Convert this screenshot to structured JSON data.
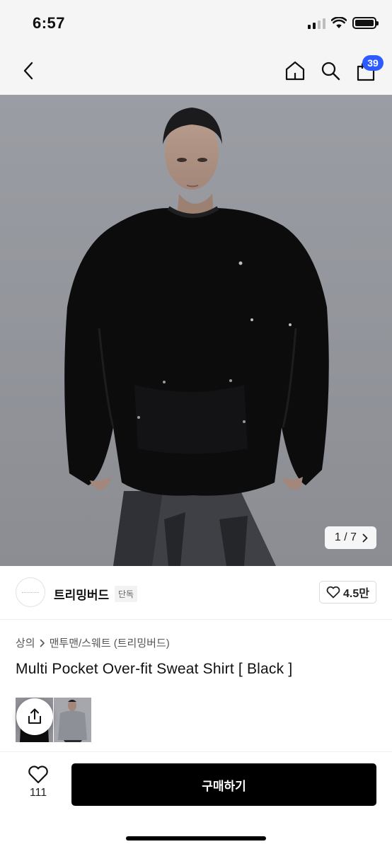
{
  "status_bar": {
    "time": "6:57",
    "icons": [
      "cellular-signal-icon",
      "wifi-icon",
      "battery-icon"
    ]
  },
  "nav": {
    "icons": [
      "back-arrow-icon",
      "home-icon",
      "search-icon",
      "shopping-bag-icon"
    ],
    "cart_count": "39",
    "badge_color": "#2d5bff"
  },
  "hero": {
    "counter_text": "1 / 7",
    "icon": "chevron-right-icon"
  },
  "brand": {
    "name": "트리밍버드",
    "tag": "단독",
    "likes": "4.5만",
    "icon": "heart-outline-icon"
  },
  "breadcrumb": {
    "items": [
      "상의",
      "맨투맨/스웨트 (트리밍버드)"
    ],
    "separator_icon": "chevron-right-icon"
  },
  "product": {
    "title": "Multi Pocket Over-fit Sweat Shirt [ Black ]"
  },
  "thumbnails": {
    "count": 2,
    "share_icon": "share-upload-icon"
  },
  "bottom_bar": {
    "wish_count": "111",
    "buy_label": "구매하기",
    "buy_color": "#000000",
    "icon": "heart-outline-icon"
  }
}
